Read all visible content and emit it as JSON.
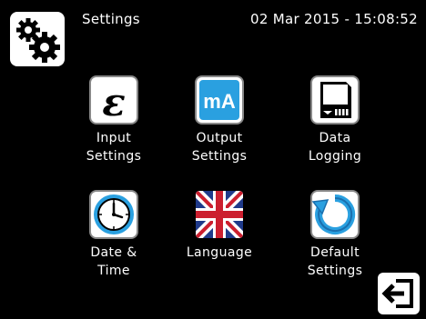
{
  "header": {
    "title": "Settings",
    "datetime": "02 Mar 2015 - 15:08:52",
    "icon": "gears-icon"
  },
  "tiles": [
    {
      "label": "Input\nSettings",
      "icon": "epsilon-icon"
    },
    {
      "label": "Output\nSettings",
      "icon": "mA-icon",
      "icon_text": "mA"
    },
    {
      "label": "Data\nLogging",
      "icon": "sd-card-icon"
    },
    {
      "label": "Date &\nTime",
      "icon": "clock-icon"
    },
    {
      "label": "Language",
      "icon": "union-flag-icon"
    },
    {
      "label": "Default\nSettings",
      "icon": "reset-arrow-icon"
    }
  ],
  "footer": {
    "exit_icon": "exit-icon"
  },
  "colors": {
    "background": "#000000",
    "accent_blue": "#2aa0e0",
    "flag_red": "#cc1f2f",
    "flag_blue": "#1f3a8a"
  }
}
